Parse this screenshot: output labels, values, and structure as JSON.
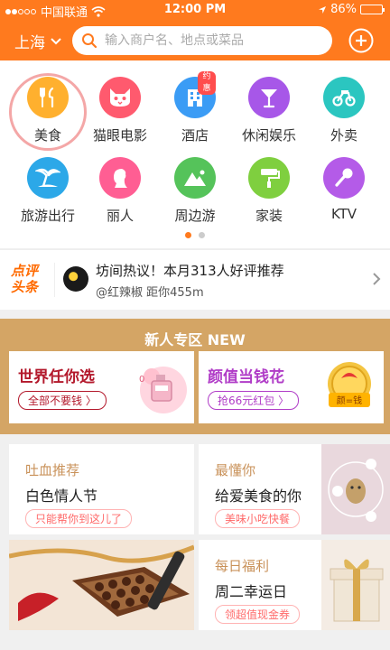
{
  "status_bar": {
    "carrier": "中国联通",
    "time": "12:00 PM",
    "battery": "86%",
    "battery_level": 0.86
  },
  "header": {
    "city": "上海",
    "search_placeholder": "输入商户名、地点或菜品"
  },
  "categories": [
    {
      "label": "美食",
      "color": "#ffb02e",
      "icon": "utensils-icon"
    },
    {
      "label": "猫眼电影",
      "color": "#ff5a6e",
      "icon": "cat-face-icon"
    },
    {
      "label": "酒店",
      "color": "#3b9cf5",
      "icon": "hotel-icon",
      "badge": "约惠"
    },
    {
      "label": "休闲娱乐",
      "color": "#a757e8",
      "icon": "cocktail-icon"
    },
    {
      "label": "外卖",
      "color": "#2bc6c0",
      "icon": "scooter-icon"
    },
    {
      "label": "旅游出行",
      "color": "#2ca8e8",
      "icon": "palm-tree-icon"
    },
    {
      "label": "丽人",
      "color": "#ff5e93",
      "icon": "woman-silhouette-icon"
    },
    {
      "label": "周边游",
      "color": "#55c35a",
      "icon": "mountain-icon"
    },
    {
      "label": "家装",
      "color": "#7fcf3f",
      "icon": "paint-roller-icon"
    },
    {
      "label": "KTV",
      "color": "#b45be8",
      "icon": "microphone-icon"
    }
  ],
  "news": {
    "logo_line1": "点评",
    "logo_line2": "头条",
    "title": "坊间热议！本月313人好评推荐",
    "subtitle": "@红辣椒  距你455m"
  },
  "newcomer": {
    "title": "新人专区 NEW",
    "cards": [
      {
        "title": "世界任你选",
        "pill": "全部不要钱 〉",
        "color": "#b3182b"
      },
      {
        "title": "颜值当钱花",
        "pill": "抢66元红包 〉",
        "color": "#b03cc7",
        "coin": "颜=钱"
      }
    ]
  },
  "promos": [
    {
      "kicker": "吐血推荐",
      "headline": "白色情人节",
      "pill": "只能帮你到这儿了"
    },
    {
      "kicker": "最懂你",
      "headline": "给爱美食的你",
      "pill": "美味小吃快餐"
    },
    {
      "kicker": "每日福利",
      "headline": "周二幸运日",
      "pill": "领超值现金券"
    }
  ],
  "colors": {
    "brand": "#ff7a1e",
    "zone_bg": "#d4a565",
    "gold": "#c9925a"
  }
}
